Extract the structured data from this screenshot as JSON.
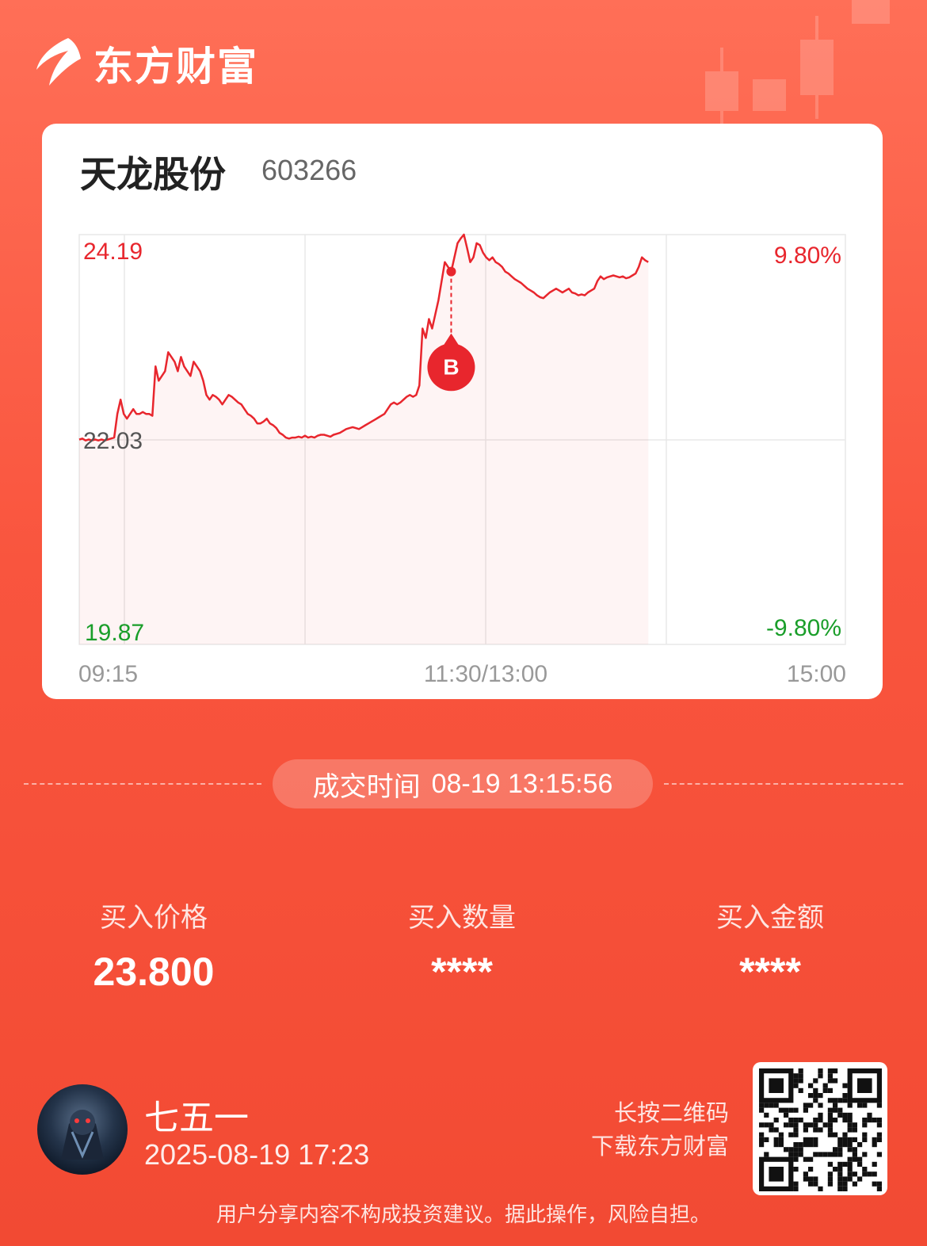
{
  "brand": {
    "name": "东方财富"
  },
  "stock": {
    "name": "天龙股份",
    "code": "603266"
  },
  "chart_data": {
    "type": "line",
    "y_top_label": "24.19",
    "y_mid_label": "22.03",
    "y_bottom_label": "19.87",
    "pct_top_label": "9.80%",
    "pct_bottom_label": "-9.80%",
    "x_labels": [
      "09:15",
      "11:30/13:00",
      "15:00"
    ],
    "ylim": [
      19.87,
      24.19
    ],
    "prev_close": 22.03,
    "marker_label": "B",
    "marker_value": 23.8,
    "marker_index": 117,
    "series": [
      {
        "values": [
          22.03,
          22.04,
          22.02,
          22.03,
          22.02,
          22.03,
          22.02,
          22.03,
          22.02,
          22.03,
          22.04,
          22.05,
          22.3,
          22.45,
          22.3,
          22.25,
          22.3,
          22.35,
          22.3,
          22.3,
          22.32,
          22.3,
          22.3,
          22.28,
          22.8,
          22.65,
          22.7,
          22.75,
          22.95,
          22.9,
          22.85,
          22.75,
          22.9,
          22.8,
          22.75,
          22.7,
          22.85,
          22.8,
          22.75,
          22.65,
          22.5,
          22.45,
          22.5,
          22.48,
          22.45,
          22.4,
          22.45,
          22.5,
          22.48,
          22.45,
          22.42,
          22.4,
          22.35,
          22.3,
          22.28,
          22.25,
          22.2,
          22.2,
          22.22,
          22.25,
          22.2,
          22.18,
          22.15,
          22.1,
          22.08,
          22.05,
          22.04,
          22.05,
          22.05,
          22.06,
          22.05,
          22.07,
          22.05,
          22.06,
          22.05,
          22.07,
          22.08,
          22.08,
          22.07,
          22.06,
          22.08,
          22.09,
          22.1,
          22.12,
          22.14,
          22.15,
          22.16,
          22.15,
          22.14,
          22.16,
          22.18,
          22.2,
          22.22,
          22.24,
          22.26,
          22.28,
          22.3,
          22.35,
          22.4,
          22.42,
          22.4,
          22.42,
          22.45,
          22.48,
          22.5,
          22.48,
          22.5,
          22.6,
          23.2,
          23.1,
          23.3,
          23.2,
          23.35,
          23.5,
          23.7,
          23.9,
          23.85,
          23.8,
          23.95,
          24.1,
          24.15,
          24.19,
          24.05,
          23.9,
          23.95,
          24.1,
          24.08,
          24.0,
          23.95,
          23.92,
          23.95,
          23.9,
          23.88,
          23.85,
          23.8,
          23.78,
          23.75,
          23.72,
          23.7,
          23.68,
          23.65,
          23.62,
          23.6,
          23.58,
          23.55,
          23.53,
          23.52,
          23.55,
          23.58,
          23.6,
          23.62,
          23.6,
          23.58,
          23.6,
          23.62,
          23.58,
          23.57,
          23.55,
          23.56,
          23.55,
          23.58,
          23.6,
          23.62,
          23.7,
          23.75,
          23.72,
          23.74,
          23.75,
          23.76,
          23.75,
          23.74,
          23.75,
          23.73,
          23.74,
          23.76,
          23.78,
          23.85,
          23.95,
          23.92,
          23.9
        ]
      }
    ],
    "x_domain": [
      "09:15",
      "15:00"
    ],
    "grid": true
  },
  "trade": {
    "time_label": "成交时间",
    "time_value": "08-19 13:15:56"
  },
  "stats": [
    {
      "label": "买入价格",
      "value": "23.800"
    },
    {
      "label": "买入数量",
      "value": "****"
    },
    {
      "label": "买入金额",
      "value": "****"
    }
  ],
  "user": {
    "name": "七五一",
    "timestamp": "2025-08-19 17:23"
  },
  "qr": {
    "hint_line1": "长按二维码",
    "hint_line2": "下载东方财富"
  },
  "disclaimer": "用户分享内容不构成投资建议。据此操作，风险自担。",
  "colors": {
    "up": "#e8262d",
    "down": "#1a9e2a",
    "accent": "#f24a33"
  }
}
